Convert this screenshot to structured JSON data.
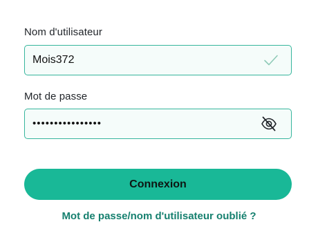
{
  "login_form": {
    "username": {
      "label": "Nom d'utilisateur",
      "value": "Mois372",
      "valid_icon": "check-icon"
    },
    "password": {
      "label": "Mot de passe",
      "value": "••••••••••••••••",
      "toggle_icon": "eye-slash-icon"
    },
    "submit_label": "Connexion",
    "forgot_link": "Mot de passe/nom d'utilisateur oublié ?"
  },
  "colors": {
    "accent": "#19b897",
    "field_border": "#35b59c",
    "field_background": "#f5fcfa",
    "link": "#16806f"
  }
}
